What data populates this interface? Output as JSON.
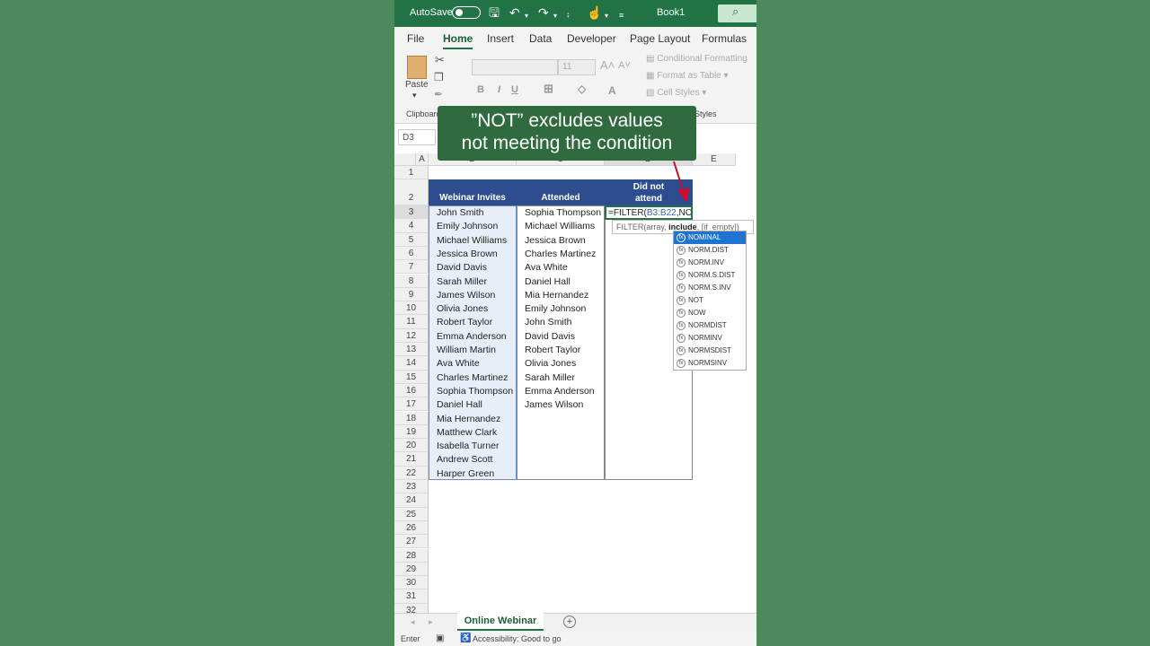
{
  "titlebar": {
    "autosave_label": "AutoSave",
    "book_title": "Book1",
    "icons": [
      "save-icon",
      "undo-icon",
      "redo-icon",
      "chart-icon",
      "touch-icon",
      "customize-icon",
      "search-icon"
    ]
  },
  "tabs": [
    "File",
    "Home",
    "Insert",
    "Data",
    "Developer",
    "Page Layout",
    "Formulas"
  ],
  "active_tab": "Home",
  "ribbon": {
    "paste_label": "Paste",
    "clipboard_label": "Clipboard",
    "font_size": "11",
    "conditional_formatting": "Conditional Formatting",
    "format_as_table": "Format as Table",
    "cell_styles": "Cell Styles",
    "styles_label": "Styles"
  },
  "callout": {
    "line1": "”NOT” excludes values",
    "line2": "not meeting the condition"
  },
  "formula_bar": {
    "name_box": "D3"
  },
  "columns": [
    "A",
    "B",
    "C",
    "D",
    "E"
  ],
  "headers": {
    "b": "Webinar Invites",
    "c": "Attended",
    "d1": "Did not",
    "d2": "attend"
  },
  "invites": [
    "John Smith",
    "Emily Johnson",
    "Michael Williams",
    "Jessica Brown",
    "David Davis",
    "Sarah Miller",
    "James Wilson",
    "Olivia Jones",
    "Robert Taylor",
    "Emma Anderson",
    "William Martin",
    "Ava White",
    "Charles Martinez",
    "Sophia Thompson",
    "Daniel Hall",
    "Mia Hernandez",
    "Matthew Clark",
    "Isabella Turner",
    "Andrew Scott",
    "Harper Green"
  ],
  "attended": [
    "Sophia Thompson",
    "Michael Williams",
    "Jessica Brown",
    "Charles Martinez",
    "Ava White",
    "Daniel Hall",
    "Mia Hernandez",
    "Emily Johnson",
    "John Smith",
    "David Davis",
    "Robert Taylor",
    "Olivia Jones",
    "Sarah Miller",
    "Emma Anderson",
    "James Wilson"
  ],
  "editing": {
    "formula_prefix": "=FILTER(",
    "formula_ref": "B3:B22",
    "formula_suffix": ",NO",
    "tooltip_a": "FILTER(array, ",
    "tooltip_b": "include",
    "tooltip_c": ", [if_empty])"
  },
  "autocomplete": [
    "NOMINAL",
    "NORM.DIST",
    "NORM.INV",
    "NORM.S.DIST",
    "NORM.S.INV",
    "NOT",
    "NOW",
    "NORMDIST",
    "NORMINV",
    "NORMSDIST",
    "NORMSINV"
  ],
  "autocomplete_selected": 0,
  "sheet_tab": "Online Webinar",
  "status": {
    "mode": "Enter",
    "accessibility": "Accessibility: Good to go"
  },
  "colors": {
    "excel_green": "#217346",
    "header_blue": "#2e4d8f",
    "selection_fill": "#e8eef7",
    "background": "#4c8a5c"
  }
}
